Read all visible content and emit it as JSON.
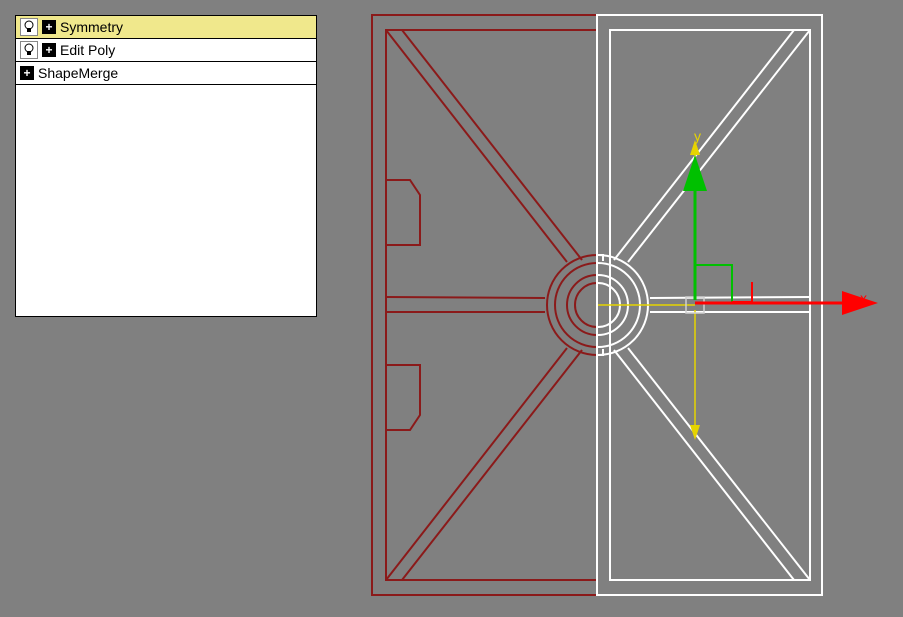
{
  "modifier_stack": {
    "items": [
      {
        "label": "Symmetry",
        "has_bulb": true,
        "selected": true
      },
      {
        "label": "Edit Poly",
        "has_bulb": true,
        "selected": false
      },
      {
        "label": "ShapeMerge",
        "has_bulb": false,
        "selected": false
      }
    ]
  },
  "viewport": {
    "axis_labels": {
      "x": "x",
      "y": "y"
    },
    "axis_colors": {
      "x": "#ff0000",
      "y": "#00c000",
      "measure": "#e6d400"
    },
    "wire_color_left": "#8b1a1a",
    "wire_color_right": "#ffffff"
  }
}
